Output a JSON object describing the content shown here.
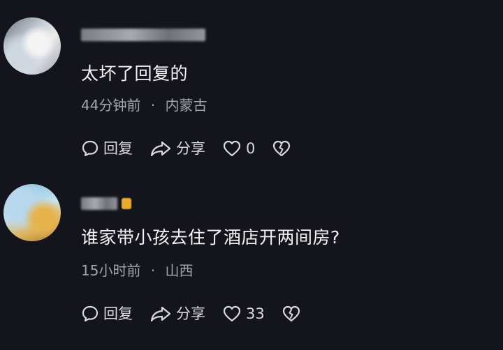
{
  "comments": [
    {
      "text": "太坏了回复的",
      "time": "44分钟前",
      "location": "内蒙古",
      "separator": "·",
      "reply_label": "回复",
      "share_label": "分享",
      "like_count": "0"
    },
    {
      "text": "谁家带小孩去住了酒店开两间房?",
      "time": "15小时前",
      "location": "山西",
      "separator": "·",
      "reply_label": "回复",
      "share_label": "分享",
      "like_count": "33"
    }
  ],
  "icons": {
    "reply": "comment-bubble-icon",
    "share": "share-arrow-icon",
    "like": "heart-icon",
    "dislike": "broken-heart-icon"
  },
  "colors": {
    "background": "#14151c",
    "text": "#f4f4f6",
    "meta": "#a3a5ad",
    "action": "#d8d9de"
  }
}
